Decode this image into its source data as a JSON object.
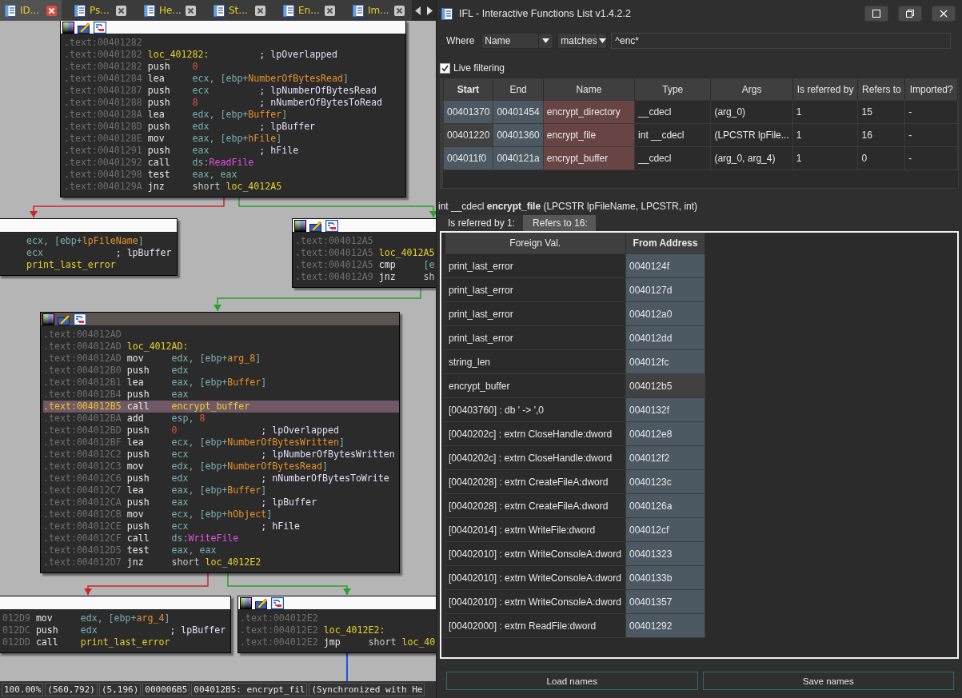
{
  "ida": {
    "tabs": [
      {
        "label": "ID...",
        "selected": true
      },
      {
        "label": "Ps...",
        "selected": false
      },
      {
        "label": "He...",
        "selected": false
      },
      {
        "label": "St...",
        "selected": false
      },
      {
        "label": "En...",
        "selected": false
      },
      {
        "label": "Im...",
        "selected": false
      }
    ],
    "blocks": [
      {
        "selected": false,
        "toolbar": true,
        "lines": [
          {
            "addr": ".text:00401282"
          },
          {
            "addr": ".text:00401282",
            "label": "loc_401282:",
            "comment": "; lpOverlapped"
          },
          {
            "addr": ".text:00401282",
            "mnem": "push",
            "ops": [
              {
                "text": "0",
                "kind": "num"
              }
            ]
          },
          {
            "addr": ".text:00401284",
            "mnem": "lea",
            "ops": [
              {
                "text": "ecx, [ebp+",
                "kind": "reg"
              },
              {
                "text": "NumberOfBytesRead",
                "kind": "var"
              },
              {
                "text": "]",
                "kind": "reg"
              }
            ]
          },
          {
            "addr": ".text:00401287",
            "mnem": "push",
            "ops": [
              {
                "text": "ecx",
                "kind": "reg"
              }
            ],
            "comment": "; lpNumberOfBytesRead"
          },
          {
            "addr": ".text:00401288",
            "mnem": "push",
            "ops": [
              {
                "text": "8",
                "kind": "num"
              }
            ],
            "comment": "; nNumberOfBytesToRead"
          },
          {
            "addr": ".text:0040128A",
            "mnem": "lea",
            "ops": [
              {
                "text": "edx, [ebp+",
                "kind": "reg"
              },
              {
                "text": "Buffer",
                "kind": "var"
              },
              {
                "text": "]",
                "kind": "reg"
              }
            ]
          },
          {
            "addr": ".text:0040128D",
            "mnem": "push",
            "ops": [
              {
                "text": "edx",
                "kind": "reg"
              }
            ],
            "comment": "; lpBuffer"
          },
          {
            "addr": ".text:0040128E",
            "mnem": "mov",
            "ops": [
              {
                "text": "eax, [ebp+",
                "kind": "reg"
              },
              {
                "text": "hFile",
                "kind": "var"
              },
              {
                "text": "]",
                "kind": "reg"
              }
            ]
          },
          {
            "addr": ".text:00401291",
            "mnem": "push",
            "ops": [
              {
                "text": "eax",
                "kind": "reg"
              }
            ],
            "comment": "; hFile"
          },
          {
            "addr": ".text:00401292",
            "mnem": "call",
            "ops": [
              {
                "text": "ds:",
                "kind": "reg"
              },
              {
                "text": "ReadFile",
                "kind": "imp"
              }
            ]
          },
          {
            "addr": ".text:00401298",
            "mnem": "test",
            "ops": [
              {
                "text": "eax, eax",
                "kind": "reg"
              }
            ]
          },
          {
            "addr": ".text:0040129A",
            "mnem": "jnz",
            "ops": [
              {
                "text": "short ",
                "kind": "txt"
              },
              {
                "text": "loc_4012A5",
                "kind": "lbl"
              }
            ]
          }
        ]
      },
      {
        "selected": false,
        "toolbar": false,
        "lines": [
          {
            "ops": [
              {
                "text": "ecx, [ebp+",
                "kind": "reg"
              },
              {
                "text": "lpFileName",
                "kind": "var"
              },
              {
                "text": "]",
                "kind": "reg"
              }
            ]
          },
          {
            "ops": [
              {
                "text": "ecx",
                "kind": "reg"
              }
            ],
            "comment": "; lpBuffer"
          },
          {
            "ops": [
              {
                "text": "print_last_error",
                "kind": "lbl"
              }
            ]
          }
        ]
      },
      {
        "selected": false,
        "toolbar": true,
        "lines": [
          {
            "addr": ".text:004012A5"
          },
          {
            "addr": ".text:004012A5",
            "label": "loc_4012A5"
          },
          {
            "addr": ".text:004012A5",
            "mnem": "cmp",
            "ops": [
              {
                "text": "[e",
                "kind": "reg"
              }
            ]
          },
          {
            "addr": ".text:004012A9",
            "mnem": "jnz",
            "ops": [
              {
                "text": "sh",
                "kind": "txt"
              }
            ]
          }
        ]
      },
      {
        "selected": true,
        "toolbar": true,
        "lines": [
          {
            "addr": ".text:004012AD",
            "selected": false
          },
          {
            "addr": ".text:004012AD",
            "label": "loc_4012AD:",
            "selected": false
          },
          {
            "addr": ".text:004012AD",
            "mnem": "mov",
            "ops": [
              {
                "text": "edx, [ebp+",
                "kind": "reg"
              },
              {
                "text": "arg_8",
                "kind": "var"
              },
              {
                "text": "]",
                "kind": "reg"
              }
            ],
            "selected": false
          },
          {
            "addr": ".text:004012B0",
            "mnem": "push",
            "ops": [
              {
                "text": "edx",
                "kind": "reg"
              }
            ],
            "selected": false
          },
          {
            "addr": ".text:004012B1",
            "mnem": "lea",
            "ops": [
              {
                "text": "eax, [ebp+",
                "kind": "reg"
              },
              {
                "text": "Buffer",
                "kind": "var"
              },
              {
                "text": "]",
                "kind": "reg"
              }
            ],
            "selected": false
          },
          {
            "addr": ".text:004012B4",
            "mnem": "push",
            "ops": [
              {
                "text": "eax",
                "kind": "reg"
              }
            ],
            "selected": false
          },
          {
            "addr": ".text:004012B5",
            "mnem": "call",
            "ops": [
              {
                "text": "encrypt_buffer",
                "kind": "lbl"
              }
            ],
            "selected": true
          },
          {
            "addr": ".text:004012BA",
            "mnem": "add",
            "ops": [
              {
                "text": "esp, ",
                "kind": "reg"
              },
              {
                "text": "8",
                "kind": "num"
              }
            ],
            "selected": false
          },
          {
            "addr": ".text:004012BD",
            "mnem": "push",
            "ops": [
              {
                "text": "0",
                "kind": "num"
              }
            ],
            "comment": "; lpOverlapped",
            "selected": false
          },
          {
            "addr": ".text:004012BF",
            "mnem": "lea",
            "ops": [
              {
                "text": "ecx, [ebp+",
                "kind": "reg"
              },
              {
                "text": "NumberOfBytesWritten",
                "kind": "var"
              },
              {
                "text": "]",
                "kind": "reg"
              }
            ],
            "selected": false
          },
          {
            "addr": ".text:004012C2",
            "mnem": "push",
            "ops": [
              {
                "text": "ecx",
                "kind": "reg"
              }
            ],
            "comment": "; lpNumberOfBytesWritten",
            "selected": false
          },
          {
            "addr": ".text:004012C3",
            "mnem": "mov",
            "ops": [
              {
                "text": "edx, [ebp+",
                "kind": "reg"
              },
              {
                "text": "NumberOfBytesRead",
                "kind": "var"
              },
              {
                "text": "]",
                "kind": "reg"
              }
            ],
            "selected": false
          },
          {
            "addr": ".text:004012C6",
            "mnem": "push",
            "ops": [
              {
                "text": "edx",
                "kind": "reg"
              }
            ],
            "comment": "; nNumberOfBytesToWrite",
            "selected": false
          },
          {
            "addr": ".text:004012C7",
            "mnem": "lea",
            "ops": [
              {
                "text": "eax, [ebp+",
                "kind": "reg"
              },
              {
                "text": "Buffer",
                "kind": "var"
              },
              {
                "text": "]",
                "kind": "reg"
              }
            ],
            "selected": false
          },
          {
            "addr": ".text:004012CA",
            "mnem": "push",
            "ops": [
              {
                "text": "eax",
                "kind": "reg"
              }
            ],
            "comment": "; lpBuffer",
            "selected": false
          },
          {
            "addr": ".text:004012CB",
            "mnem": "mov",
            "ops": [
              {
                "text": "ecx, [ebp+",
                "kind": "reg"
              },
              {
                "text": "hObject",
                "kind": "var"
              },
              {
                "text": "]",
                "kind": "reg"
              }
            ],
            "selected": false
          },
          {
            "addr": ".text:004012CE",
            "mnem": "push",
            "ops": [
              {
                "text": "ecx",
                "kind": "reg"
              }
            ],
            "comment": "; hFile",
            "selected": false
          },
          {
            "addr": ".text:004012CF",
            "mnem": "call",
            "ops": [
              {
                "text": "ds:",
                "kind": "reg"
              },
              {
                "text": "WriteFile",
                "kind": "imp"
              }
            ],
            "selected": false
          },
          {
            "addr": ".text:004012D5",
            "mnem": "test",
            "ops": [
              {
                "text": "eax, eax",
                "kind": "reg"
              }
            ],
            "selected": false
          },
          {
            "addr": ".text:004012D7",
            "mnem": "jnz",
            "ops": [
              {
                "text": "short ",
                "kind": "txt"
              },
              {
                "text": "loc_4012E2",
                "kind": "lbl"
              }
            ],
            "selected": false
          }
        ]
      },
      {
        "selected": false,
        "toolbar": false,
        "lines": [
          {
            "addr": "012D9",
            "mnem": "mov",
            "ops": [
              {
                "text": "edx, [ebp+",
                "kind": "reg"
              },
              {
                "text": "arg_4",
                "kind": "var"
              },
              {
                "text": "]",
                "kind": "reg"
              }
            ]
          },
          {
            "addr": "012DC",
            "mnem": "push",
            "ops": [
              {
                "text": "edx",
                "kind": "reg"
              }
            ],
            "comment": "; lpBuffer"
          },
          {
            "addr": "012DD",
            "mnem": "call",
            "ops": [
              {
                "text": "print_last_error",
                "kind": "lbl"
              }
            ]
          }
        ]
      },
      {
        "selected": false,
        "toolbar": true,
        "lines": [
          {
            "addr": ".text:004012E2"
          },
          {
            "addr": ".text:004012E2",
            "label": "loc_4012E2:"
          },
          {
            "addr": ".text:004012E2",
            "mnem": "jmp",
            "ops": [
              {
                "text": "short ",
                "kind": "txt"
              },
              {
                "text": "loc_40",
                "kind": "lbl"
              }
            ]
          }
        ]
      }
    ],
    "status_bar": [
      "100.00%",
      "(560,792)",
      "(5,196)",
      "000006B5",
      "004012B5: encrypt_fil",
      "(Synchronized with He"
    ]
  },
  "ifl": {
    "title": "IFL - Interactive Functions List v1.4.2.2",
    "filter": {
      "label": "Where",
      "field": "Name",
      "operator": "matches",
      "pattern": "^enc*",
      "live_filtering": {
        "label": "Live filtering",
        "checked": true
      }
    },
    "functions": {
      "columns": [
        {
          "label": "Start",
          "bold": true
        },
        {
          "label": "End",
          "bold": false
        },
        {
          "label": "Name",
          "bold": false
        },
        {
          "label": "Type",
          "bold": false
        },
        {
          "label": "Args",
          "bold": false
        },
        {
          "label": "Is referred by",
          "bold": false
        },
        {
          "label": "Refers to",
          "bold": false
        },
        {
          "label": "Imported?",
          "bold": false
        }
      ],
      "rows": [
        {
          "cells": [
            "00401370",
            "00401454",
            "encrypt_directory",
            "__cdecl",
            "(arg_0)",
            "1",
            "15",
            "-"
          ],
          "selected": false
        },
        {
          "cells": [
            "00401220",
            "00401360",
            "encrypt_file",
            "int __cdecl",
            "(LPCSTR lpFile...",
            "1",
            "16",
            "-"
          ],
          "selected": true
        },
        {
          "cells": [
            "004011f0",
            "0040121a",
            "encrypt_buffer",
            "__cdecl",
            "(arg_0, arg_4)",
            "1",
            "0",
            "-"
          ],
          "selected": false
        }
      ]
    },
    "signature": "int __cdecl **encrypt_file** (LPCSTR lpFileName, LPCSTR, int)",
    "detail_tabs": [
      {
        "label": "Is referred by 1:",
        "selected": false
      },
      {
        "label": "Refers to 16:",
        "selected": true
      }
    ],
    "references": {
      "columns": [
        {
          "label": "Foreign Val.",
          "bold": false
        },
        {
          "label": "From Address",
          "bold": true
        }
      ],
      "rows": [
        {
          "cells": [
            "print_last_error",
            "0040124f"
          ],
          "selected": false
        },
        {
          "cells": [
            "print_last_error",
            "0040127d"
          ],
          "selected": false
        },
        {
          "cells": [
            "print_last_error",
            "004012a0"
          ],
          "selected": false
        },
        {
          "cells": [
            "print_last_error",
            "004012dd"
          ],
          "selected": false
        },
        {
          "cells": [
            "string_len",
            "004012fc"
          ],
          "selected": false
        },
        {
          "cells": [
            "encrypt_buffer",
            "004012b5"
          ],
          "selected": true
        },
        {
          "cells": [
            "[00403760] : db ' -> ',0",
            "0040132f"
          ],
          "selected": false
        },
        {
          "cells": [
            "[0040202c] : extrn CloseHandle:dword",
            "004012e8"
          ],
          "selected": false
        },
        {
          "cells": [
            "[0040202c] : extrn CloseHandle:dword",
            "004012f2"
          ],
          "selected": false
        },
        {
          "cells": [
            "[00402028] : extrn CreateFileA:dword",
            "0040123c"
          ],
          "selected": false
        },
        {
          "cells": [
            "[00402028] : extrn CreateFileA:dword",
            "0040126a"
          ],
          "selected": false
        },
        {
          "cells": [
            "[00402014] : extrn WriteFile:dword",
            "004012cf"
          ],
          "selected": false
        },
        {
          "cells": [
            "[00402010] : extrn WriteConsoleA:dword",
            "00401323"
          ],
          "selected": false
        },
        {
          "cells": [
            "[00402010] : extrn WriteConsoleA:dword",
            "0040133b"
          ],
          "selected": false
        },
        {
          "cells": [
            "[00402010] : extrn WriteConsoleA:dword",
            "00401357"
          ],
          "selected": false
        },
        {
          "cells": [
            "[00402000] : extrn ReadFile:dword",
            "00401292"
          ],
          "selected": false
        }
      ]
    },
    "buttons": [
      "Load names",
      "Save names"
    ]
  }
}
